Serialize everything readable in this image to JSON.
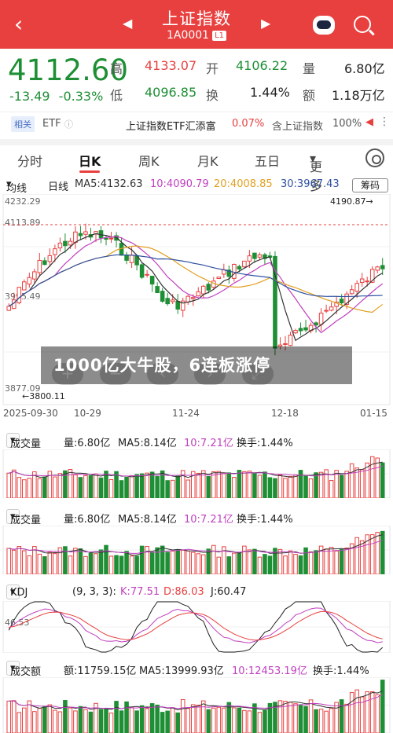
{
  "header": {
    "back_icon": "‹",
    "prev_icon": "◀",
    "next_icon": "▶",
    "title": "上证指数",
    "code": "1A0001",
    "code_tag": "L1"
  },
  "quote": {
    "price": "4112.60",
    "change": "-13.49",
    "change_pct": "-0.33%",
    "high_label": "高",
    "high": "4133.07",
    "open_label": "开",
    "open": "4106.22",
    "vol_label": "量",
    "vol": "6.80亿",
    "low_label": "低",
    "low": "4096.85",
    "turnover_label": "换",
    "turnover": "1.44%",
    "amount_label": "额",
    "amount": "1.18万亿"
  },
  "etf": {
    "tag": "相关",
    "etf": "ETF",
    "name": "上证指数ETF汇添富",
    "name_pct": "0.07%",
    "contains": "含上证指数",
    "contains_pct": "100%"
  },
  "tabs": [
    "分时",
    "日K",
    "周K",
    "月K",
    "五日",
    "更多"
  ],
  "ma": {
    "type": "均线",
    "period": "日线",
    "ma5": "MA5:4132.63",
    "ma10": "10:4090.79",
    "ma20": "20:4008.85",
    "ma30": "30:3967.43",
    "adjust": "筹码"
  },
  "yaxis": [
    "4232.29",
    "4113.89",
    "3995.49",
    "3877.09"
  ],
  "annotations": {
    "high": "4190.87→",
    "low": "←3800.11"
  },
  "dates": [
    "2025-09-30",
    "10-29",
    "11-24",
    "12-18",
    "01-15"
  ],
  "volume_panel": {
    "sel": "成交量",
    "vol": "量:6.80亿",
    "ma5": "MA5:8.14亿",
    "ma10": "10:7.21亿",
    "turn": "换手:1.44%"
  },
  "kdj_panel": {
    "sel": "KDJ",
    "params": "(9, 3, 3):",
    "k": "K:77.51",
    "d": "D:86.03",
    "j": "J:60.47",
    "axis": "46.53"
  },
  "amount_panel": {
    "sel": "成交额",
    "amount": "额:11759.15亿",
    "ma5": "MA5:13999.93亿",
    "ma10": "10:12453.19亿",
    "turn": "换手:1.44%"
  },
  "banner": "1000亿大牛股，6连板涨停",
  "controls": [
    "+",
    "−",
    "‹",
    "›",
    "⤢"
  ],
  "colors": {
    "up": "#e8403f",
    "down": "#1e8f35",
    "ma5": "#333333",
    "ma10": "#c040c0",
    "ma20": "#e0a020",
    "ma30": "#3050a0"
  }
}
